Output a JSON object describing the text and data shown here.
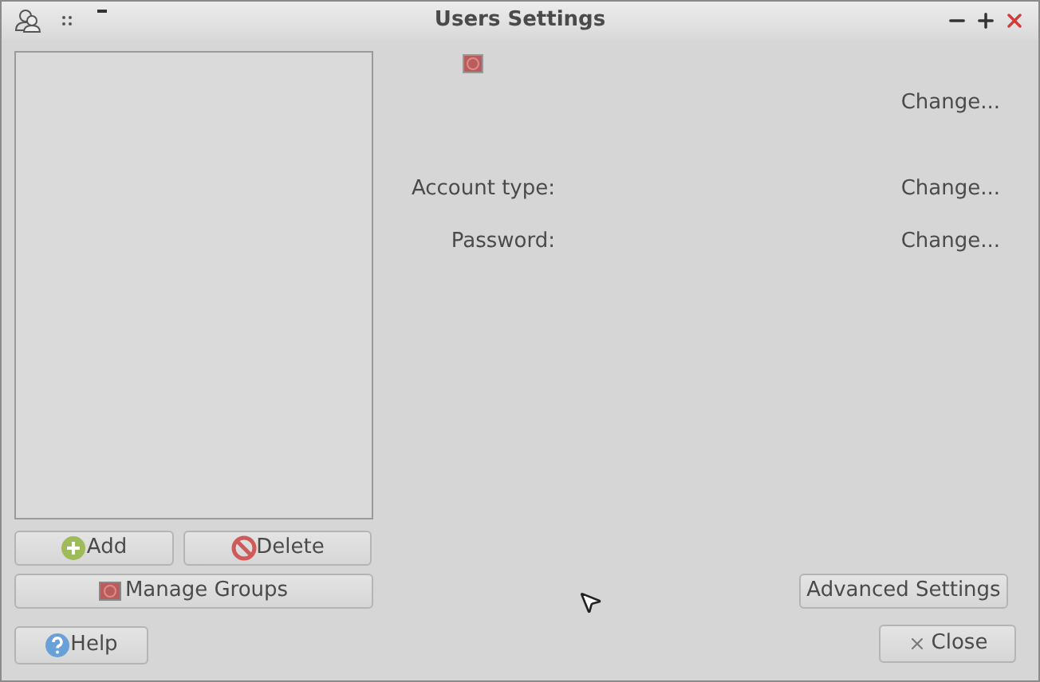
{
  "window": {
    "title": "Users Settings"
  },
  "user_list": {
    "buttons": [
      {
        "label": "Add",
        "kind": "add"
      },
      {
        "label": "Delete",
        "kind": "delete"
      }
    ],
    "manage_groups": "Manage Groups"
  },
  "details": {
    "rows": [
      {
        "label": "",
        "action": "Change..."
      },
      {
        "label": "Account type:",
        "action": "Change..."
      },
      {
        "label": "Password:",
        "action": "Change..."
      }
    ],
    "advanced": "Advanced Settings"
  },
  "footer": {
    "help": "Help",
    "close": "Close"
  }
}
